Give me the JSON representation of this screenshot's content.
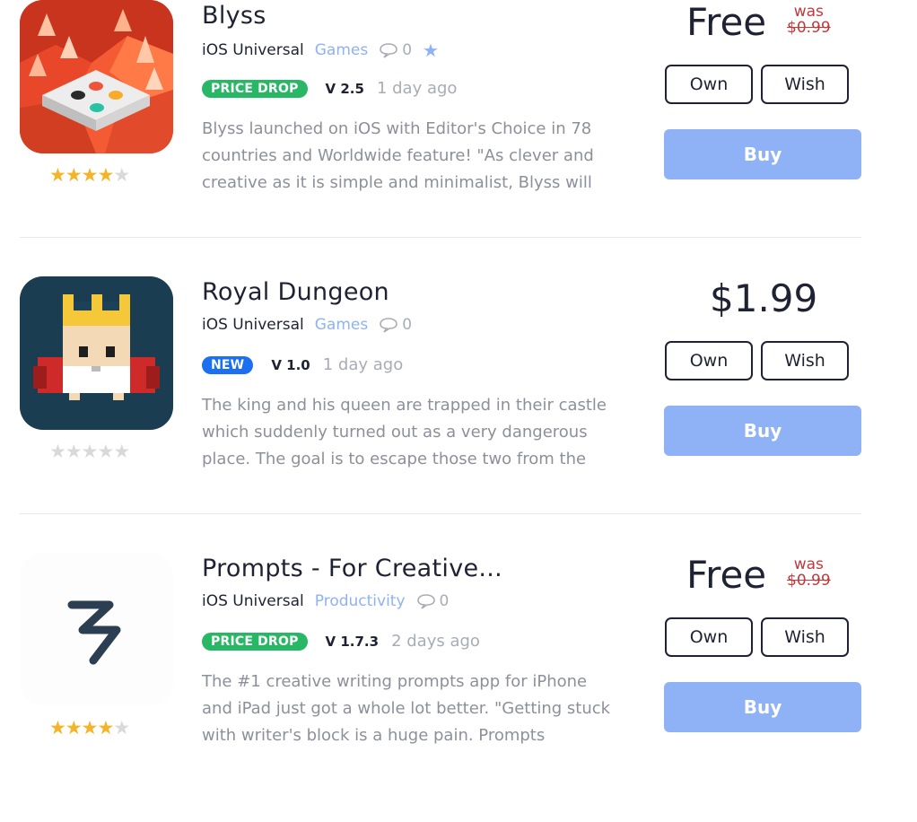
{
  "apps": [
    {
      "title": "Blyss",
      "platform": "iOS Universal",
      "category": "Games",
      "comment_count": "0",
      "has_favorite_star": true,
      "badge": "PRICE DROP",
      "version": "V 2.5",
      "updated": "1 day ago",
      "description_lines": [
        "Blyss launched on iOS with Editor's Choice in 78",
        "countries and Worldwide feature! \"As clever and",
        "creative as it is simple and minimalist, Blyss will"
      ],
      "rating": 4,
      "price": "Free",
      "was_label": "was",
      "was_price": "$0.99",
      "own_label": "Own",
      "wish_label": "Wish",
      "buy_label": "Buy",
      "icon": "blyss-app-icon"
    },
    {
      "title": "Royal Dungeon",
      "platform": "iOS Universal",
      "category": "Games",
      "comment_count": "0",
      "badge": "NEW",
      "version": "V 1.0",
      "updated": "1 day ago",
      "description_lines": [
        "The king and his queen are trapped in their castle",
        "which suddenly turned out as a very dangerous",
        "place. The goal is to escape those two from the"
      ],
      "rating": 0,
      "price": "$1.99",
      "own_label": "Own",
      "wish_label": "Wish",
      "buy_label": "Buy",
      "icon": "royal-dungeon-app-icon"
    },
    {
      "title": "Prompts - For Creative...",
      "platform": "iOS Universal",
      "category": "Productivity",
      "comment_count": "0",
      "badge": "PRICE DROP",
      "version": "V 1.7.3",
      "updated": "2 days ago",
      "description_lines": [
        "The #1 creative writing prompts app for iPhone",
        "and iPad just got a whole lot better. \"Getting stuck",
        "with writer's block is a huge pain. Prompts"
      ],
      "rating": 4,
      "price": "Free",
      "was_label": "was",
      "was_price": "$0.99",
      "own_label": "Own",
      "wish_label": "Wish",
      "buy_label": "Buy",
      "icon": "prompts-app-icon"
    }
  ],
  "colors": {
    "accent": "#8fb1f6",
    "price_drop_badge": "#28b765",
    "new_badge": "#1c6ff1",
    "was_price": "#c0393b",
    "star_on": "#f5b328",
    "star_off": "#d9d9d9"
  }
}
